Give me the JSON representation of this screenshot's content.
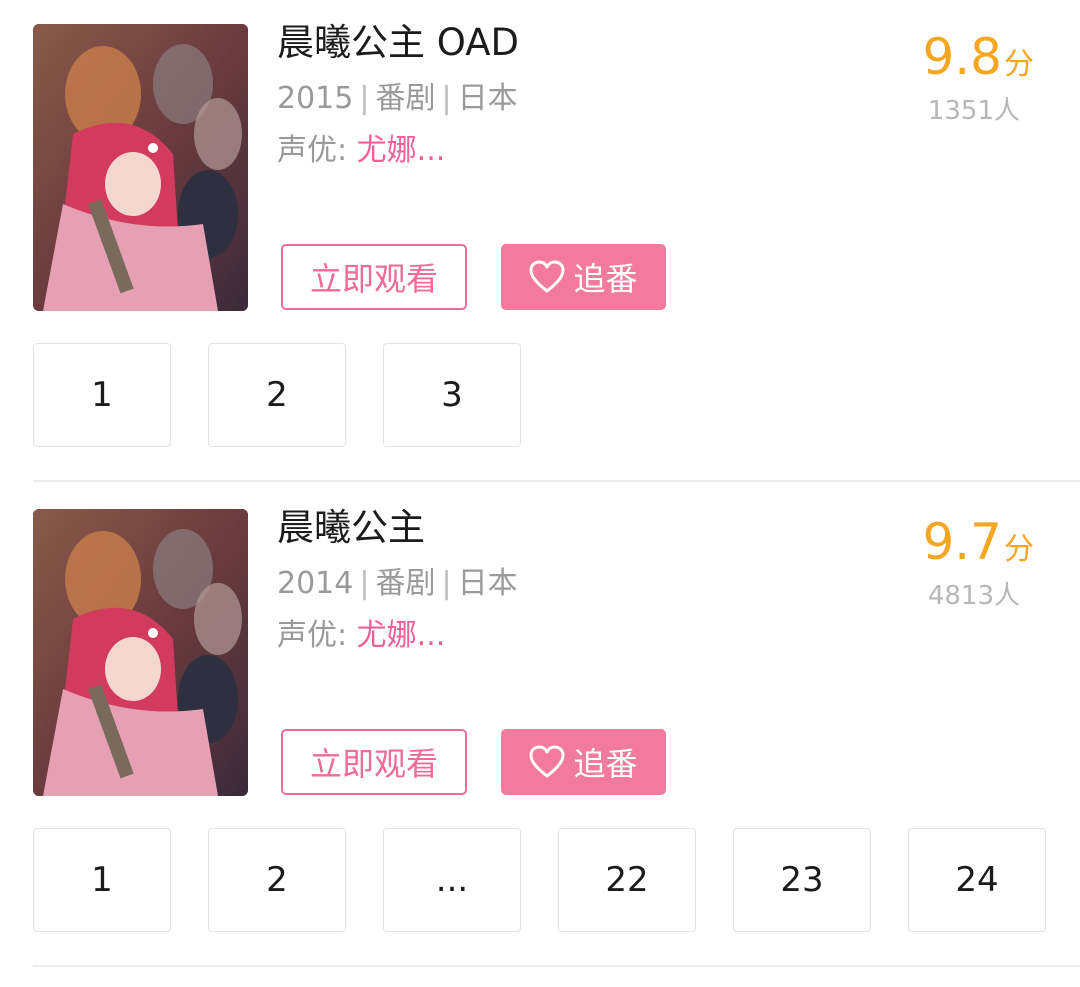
{
  "cards": [
    {
      "title": "晨曦公主 OAD",
      "year": "2015",
      "category": "番剧",
      "region": "日本",
      "cv_label": "声优: ",
      "cv_value": "尤娜...",
      "score_value": "9.8",
      "score_unit": "分",
      "votes": "1351人",
      "watch_label": "立即观看",
      "follow_label": "追番",
      "episodes": [
        "1",
        "2",
        "3"
      ]
    },
    {
      "title": "晨曦公主",
      "year": "2014",
      "category": "番剧",
      "region": "日本",
      "cv_label": "声优: ",
      "cv_value": "尤娜...",
      "score_value": "9.7",
      "score_unit": "分",
      "votes": "4813人",
      "watch_label": "立即观看",
      "follow_label": "追番",
      "episodes": [
        "1",
        "2",
        "...",
        "22",
        "23",
        "24"
      ]
    }
  ],
  "separator": "|",
  "colors": {
    "accent_pink": "#f06c97",
    "button_pink": "#f27a9f",
    "score_orange": "#f5a623",
    "muted_gray": "#9a9a9a"
  },
  "icons": {
    "follow": "heart-outline-icon"
  }
}
